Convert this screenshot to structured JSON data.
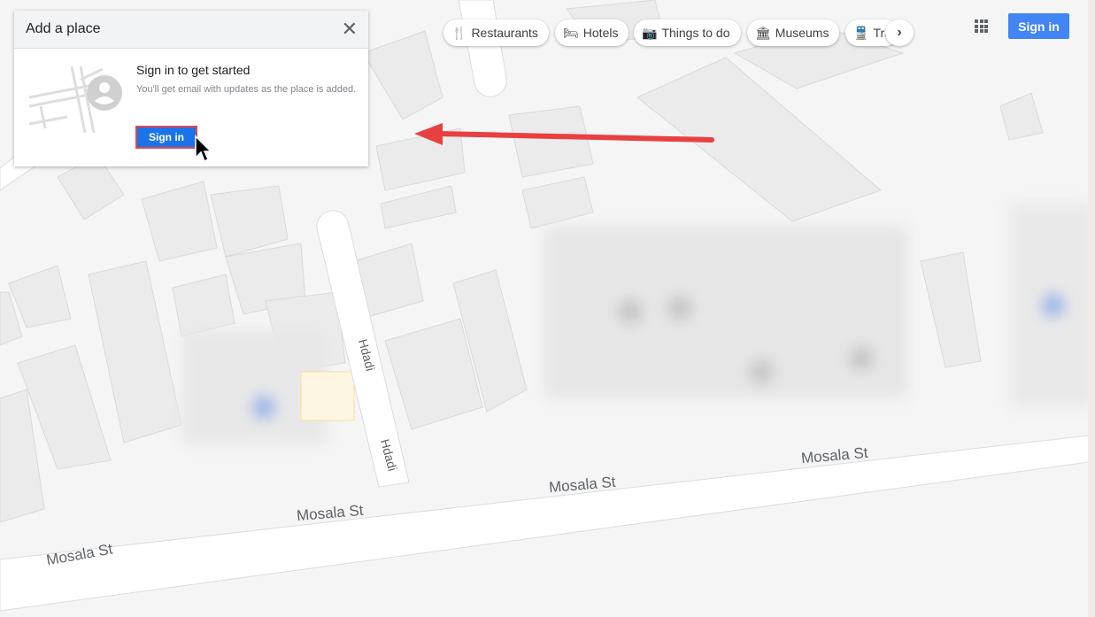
{
  "panel": {
    "title": "Add a place",
    "close_icon": "close-icon",
    "heading": "Sign in to get started",
    "description": "You'll get email with updates as the place is added.",
    "sign_in": "Sign in"
  },
  "chips": [
    {
      "label": "Restaurants",
      "icon": "fork-knife-icon",
      "glyph": "🍴"
    },
    {
      "label": "Hotels",
      "icon": "bed-icon",
      "glyph": "🛏"
    },
    {
      "label": "Things to do",
      "icon": "camera-icon",
      "glyph": "📷"
    },
    {
      "label": "Museums",
      "icon": "museum-icon",
      "glyph": "🏛"
    },
    {
      "label": "Transit",
      "icon": "train-icon",
      "glyph": "🚆"
    }
  ],
  "header": {
    "sign_in": "Sign in",
    "apps_icon": "apps-grid-icon"
  },
  "streets": {
    "main": "Mosala St",
    "side": "Hdadi"
  },
  "colors": {
    "accent": "#4285f4",
    "button": "#1a73e8",
    "arrow": "#e84040",
    "highlight": "#e04848"
  }
}
